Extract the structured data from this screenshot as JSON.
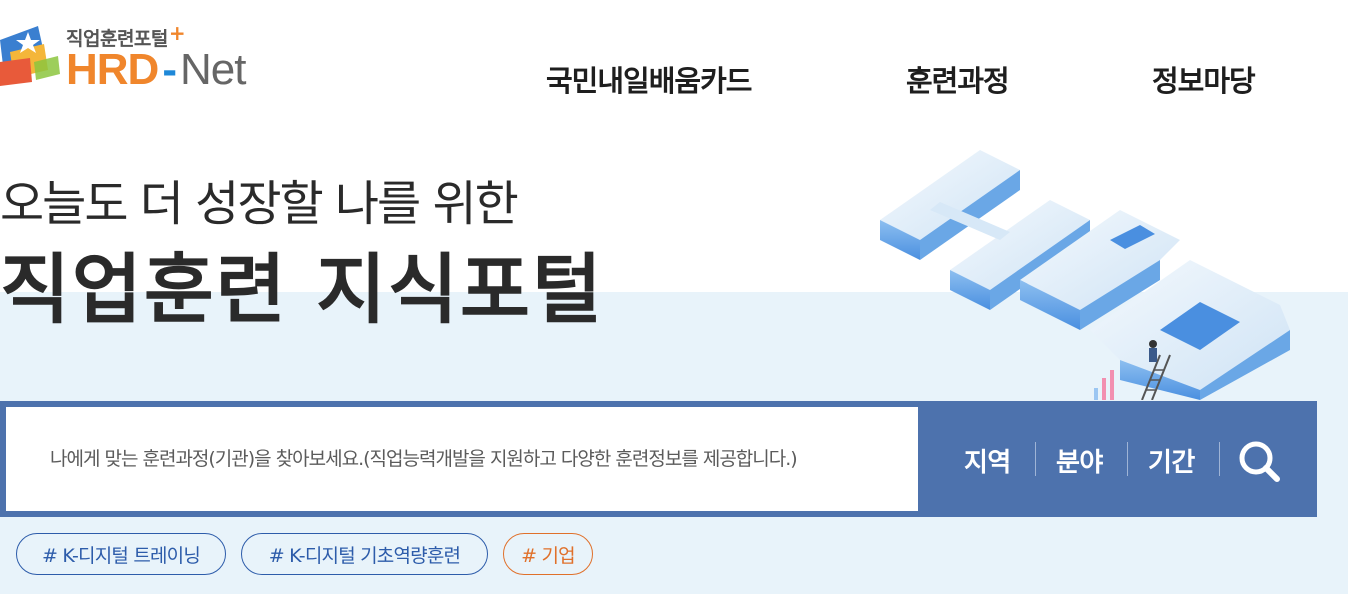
{
  "header": {
    "logo_small_text": "직업훈련포털",
    "logo_plus": "+",
    "logo_hrd": "HRD",
    "logo_dash": "-",
    "logo_net": "Net",
    "nav": [
      "국민내일배움카드",
      "훈련과정",
      "정보마당"
    ]
  },
  "hero": {
    "subtitle": "오늘도 더 성장할 나를 위한",
    "title": "직업훈련 지식포털"
  },
  "search": {
    "placeholder": "나에게 맞는 훈련과정(기관)을 찾아보세요.(직업능력개발을 지원하고 다양한 훈련정보를 제공합니다.)",
    "filters": [
      "지역",
      "분야",
      "기간"
    ],
    "button_icon": "search-icon"
  },
  "tags": [
    "# K-디지털 트레이닝",
    "# K-디지털 기초역량훈련",
    "# 기업"
  ],
  "colors": {
    "accent_orange": "#f0862c",
    "search_bar": "#4d72ad",
    "band_bg": "#e8f3fa",
    "tag_blue": "#2d5caa",
    "tag_orange": "#e0702a"
  }
}
